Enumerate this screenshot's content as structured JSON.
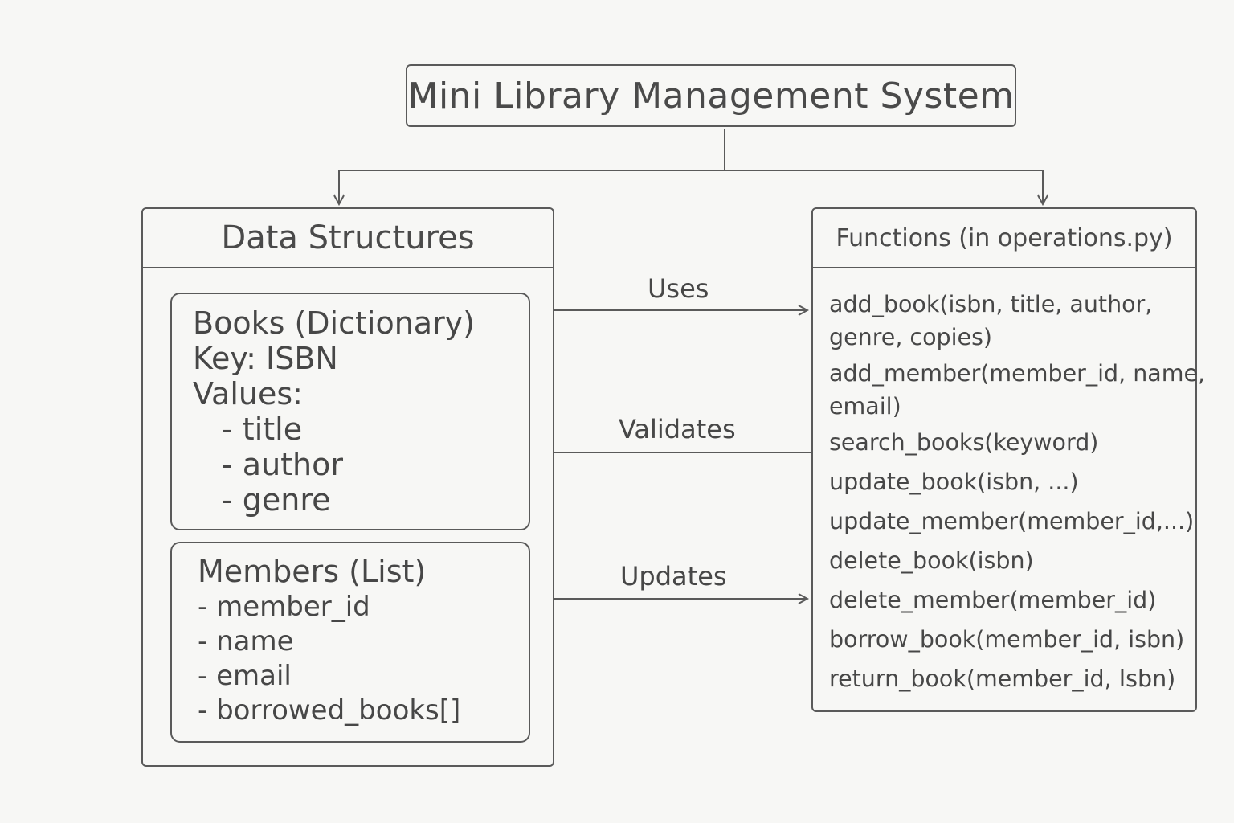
{
  "title": "Mini Library Management System",
  "data_structures": {
    "header": "Data Structures",
    "books": {
      "lines": [
        "Books (Dictionary)",
        "Key: ISBN",
        "Values:"
      ],
      "values": [
        "- title",
        "- author",
        "- genre"
      ]
    },
    "members": {
      "heading": "Members (List)",
      "fields": [
        "- member_id",
        "- name",
        "- email",
        "- borrowed_books[]"
      ]
    }
  },
  "functions": {
    "header": "Functions (in operations.py)",
    "items": [
      [
        "add_book(isbn, title, author,",
        "genre, copies)"
      ],
      [
        "add_member(member_id, name,",
        "email)"
      ],
      [
        "search_books(keyword)"
      ],
      [
        "update_book(isbn, ...)"
      ],
      [
        "update_member(member_id,...)"
      ],
      [
        "delete_book(isbn)"
      ],
      [
        "delete_member(member_id)"
      ],
      [
        "borrow_book(member_id, isbn)"
      ],
      [
        "return_book(member_id, Isbn)"
      ]
    ]
  },
  "connections": {
    "uses": "Uses",
    "validates": "Validates",
    "updates": "Updates"
  },
  "colors": {
    "stroke": "#5a5a5a",
    "text": "#474747",
    "background": "#f7f7f5"
  }
}
